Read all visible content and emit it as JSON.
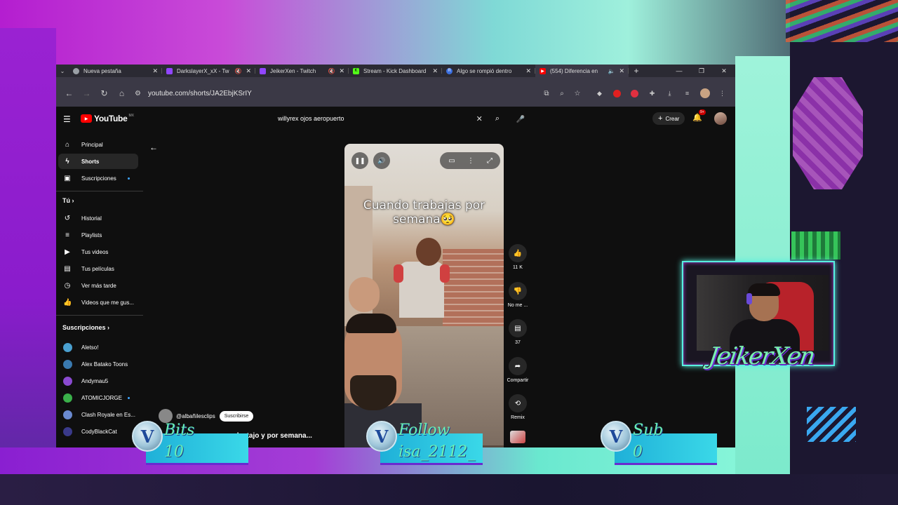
{
  "browser": {
    "tabs": [
      {
        "title": "Nueva pestaña",
        "favicon": "chrome-icon",
        "color": "#9aa0a6",
        "muted": false,
        "active": false
      },
      {
        "title": "DarkslayerX_xX - Tw",
        "favicon": "twitch-icon",
        "color": "#9146ff",
        "muted": true,
        "active": false
      },
      {
        "title": "JeikerXen - Twitch",
        "favicon": "twitch-icon",
        "color": "#9146ff",
        "muted": true,
        "active": false
      },
      {
        "title": "Stream - Kick Dashboard",
        "favicon": "kick-icon",
        "color": "#53fc18",
        "muted": false,
        "active": false
      },
      {
        "title": "Algo se rompió dentro",
        "favicon": "r-icon",
        "color": "#3b6fe0",
        "muted": false,
        "active": false
      },
      {
        "title": "(554) Diferencia en",
        "favicon": "youtube-icon",
        "color": "#ff0000",
        "muted": true,
        "active": true
      }
    ],
    "url": "youtube.com/shorts/JA2EbjKSrIY"
  },
  "youtube": {
    "logo_text": "YouTube",
    "region": "MX",
    "search_query": "willyrex ojos aeropuerto",
    "create_label": "Crear",
    "notifications_badge": "9+",
    "sidebar": {
      "main": [
        {
          "label": "Principal",
          "icon": "home-icon"
        },
        {
          "label": "Shorts",
          "icon": "shorts-icon",
          "active": true
        },
        {
          "label": "Suscripciones",
          "icon": "subscriptions-icon",
          "new_dot": true
        }
      ],
      "you_title": "Tú",
      "you": [
        {
          "label": "Historial",
          "icon": "history-icon"
        },
        {
          "label": "Playlists",
          "icon": "playlist-icon"
        },
        {
          "label": "Tus videos",
          "icon": "video-icon"
        },
        {
          "label": "Tus películas",
          "icon": "movies-icon"
        },
        {
          "label": "Ver más tarde",
          "icon": "clock-icon"
        },
        {
          "label": "Videos que me gus...",
          "icon": "thumb-up-icon"
        }
      ],
      "subs_title": "Suscripciones",
      "subscriptions": [
        {
          "label": "Aletso!",
          "color": "#4aa0d0"
        },
        {
          "label": "Alex Batako Toons",
          "color": "#3a7ab0"
        },
        {
          "label": "Andymau5",
          "color": "#8a4ad0"
        },
        {
          "label": "ATOMICJORGE",
          "color": "#3ab04a",
          "new_dot": true
        },
        {
          "label": "Clash Royale en Es...",
          "color": "#6a8ad0"
        },
        {
          "label": "CodyBlackCat",
          "color": "#3a3a8a"
        }
      ]
    },
    "short": {
      "caption_line1": "Cuando trabajas por",
      "caption_line2": "semana🥺",
      "channel": "@albañilesclips",
      "subscribe_label": "Suscribirse",
      "title": "a destajo y por semana...",
      "likes": "11 K",
      "dislike_label": "No me ...",
      "comments": "37",
      "share_label": "Compartir",
      "remix_label": "Remix"
    }
  },
  "overlay": {
    "streamer_name": "JeikerXen",
    "alerts": [
      {
        "label": "Bits",
        "value": "10"
      },
      {
        "label": "Follow",
        "value": "isa_2112_"
      },
      {
        "label": "Sub",
        "value": "0"
      }
    ]
  }
}
